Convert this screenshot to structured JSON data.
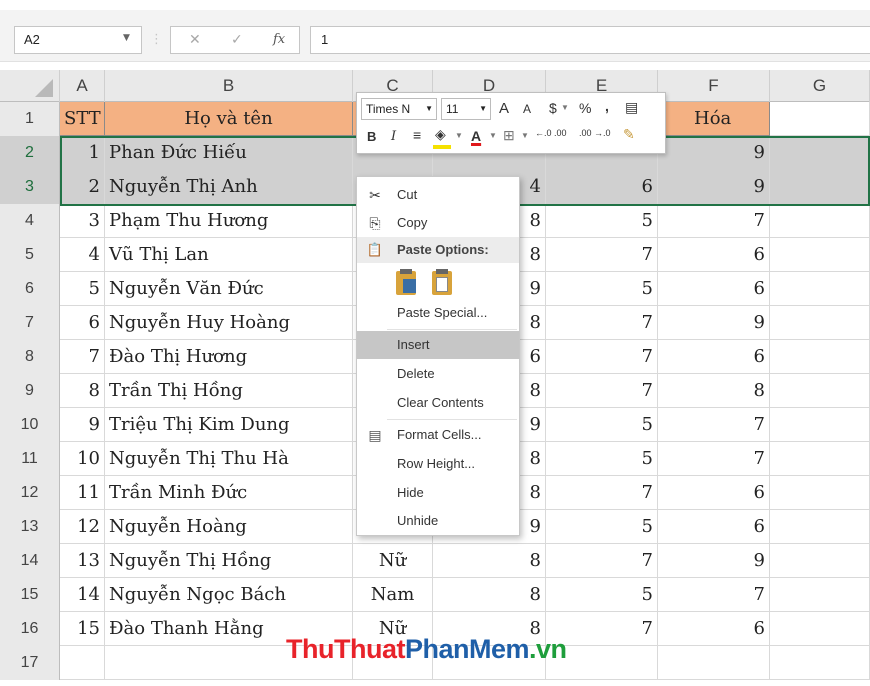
{
  "formula_bar": {
    "name_box": "A2",
    "fx_label": "fx",
    "formula_value": "1"
  },
  "columns": [
    "A",
    "B",
    "C",
    "D",
    "E",
    "F",
    "G"
  ],
  "rows": [
    {
      "num": "1",
      "a": "STT",
      "b": "Họ và tên",
      "c": "G",
      "d": "",
      "e": "",
      "f": "Hóa"
    },
    {
      "num": "2",
      "a": "1",
      "b": "Phan Đức Hiếu",
      "c": "",
      "d": "",
      "e": "",
      "f": "9"
    },
    {
      "num": "3",
      "a": "2",
      "b": "Nguyễn Thị Anh",
      "c": "",
      "d": "4",
      "e": "6",
      "f": "9"
    },
    {
      "num": "4",
      "a": "3",
      "b": "Phạm Thu Hương",
      "c": "",
      "d": "8",
      "e": "5",
      "f": "7"
    },
    {
      "num": "5",
      "a": "4",
      "b": "Vũ Thị Lan",
      "c": "",
      "d": "8",
      "e": "7",
      "f": "6"
    },
    {
      "num": "6",
      "a": "5",
      "b": "Nguyễn Văn Đức",
      "c": "",
      "d": "9",
      "e": "5",
      "f": "6"
    },
    {
      "num": "7",
      "a": "6",
      "b": "Nguyễn Huy Hoàng",
      "c": "",
      "d": "8",
      "e": "7",
      "f": "9"
    },
    {
      "num": "8",
      "a": "7",
      "b": "Đào Thị Hương",
      "c": "",
      "d": "6",
      "e": "7",
      "f": "6"
    },
    {
      "num": "9",
      "a": "8",
      "b": "Trần Thị Hồng",
      "c": "",
      "d": "8",
      "e": "7",
      "f": "8"
    },
    {
      "num": "10",
      "a": "9",
      "b": "Triệu Thị Kim Dung",
      "c": "",
      "d": "9",
      "e": "5",
      "f": "7"
    },
    {
      "num": "11",
      "a": "10",
      "b": "Nguyễn Thị Thu Hà",
      "c": "",
      "d": "8",
      "e": "5",
      "f": "7"
    },
    {
      "num": "12",
      "a": "11",
      "b": "Trần Minh Đức",
      "c": "",
      "d": "8",
      "e": "7",
      "f": "6"
    },
    {
      "num": "13",
      "a": "12",
      "b": "Nguyễn Hoàng",
      "c": "Nam",
      "d": "9",
      "e": "5",
      "f": "6"
    },
    {
      "num": "14",
      "a": "13",
      "b": "Nguyễn Thị Hồng",
      "c": "Nữ",
      "d": "8",
      "e": "7",
      "f": "9"
    },
    {
      "num": "15",
      "a": "14",
      "b": "Nguyễn Ngọc Bách",
      "c": "Nam",
      "d": "8",
      "e": "5",
      "f": "7"
    },
    {
      "num": "16",
      "a": "15",
      "b": "Đào Thanh Hằng",
      "c": "Nữ",
      "d": "8",
      "e": "7",
      "f": "6"
    },
    {
      "num": "17",
      "a": "",
      "b": "",
      "c": "",
      "d": "",
      "e": "",
      "f": ""
    }
  ],
  "mini_toolbar": {
    "font_name": "Times N",
    "font_size": "11",
    "grow_font": "A",
    "shrink_font": "A",
    "currency": "$",
    "percent": "%",
    "comma": ",",
    "bold": "B",
    "italic": "I",
    "font_color_letter": "A",
    "decimal_increase": "←.0 .00",
    "decimal_decrease": ".00 →.0"
  },
  "context_menu": {
    "cut": "Cut",
    "copy": "Copy",
    "paste_options": "Paste Options:",
    "paste_special": "Paste Special...",
    "insert": "Insert",
    "delete": "Delete",
    "clear_contents": "Clear Contents",
    "format_cells": "Format Cells...",
    "row_height": "Row Height...",
    "hide": "Hide",
    "unhide": "Unhide"
  },
  "watermark": {
    "part1": "ThuThuat",
    "part2": "PhanMem",
    "part3": ".vn"
  },
  "colors": {
    "header_fill": "#f4b183",
    "selection_border": "#217346",
    "selected_row_fill": "#d0d0d0",
    "menu_highlight": "#c6c6c6"
  }
}
